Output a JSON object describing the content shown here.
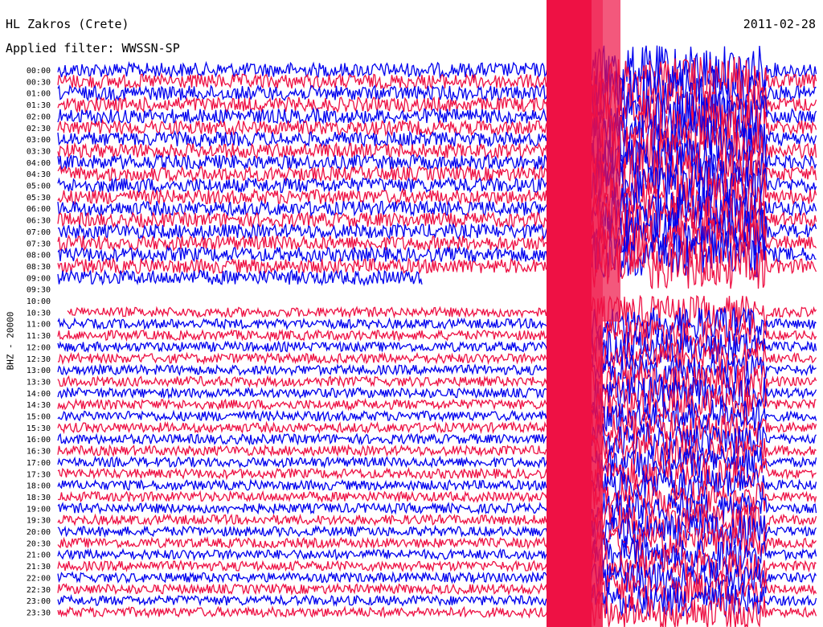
{
  "header": {
    "station": "HL Zakros (Crete)",
    "date": "2011-02-28",
    "filter_label": "Applied filter: WWSSN-SP"
  },
  "chart_data": {
    "type": "line",
    "title": "HL Zakros (Crete)",
    "subtitle": "Applied filter: WWSSN-SP",
    "ylabel": "BHZ - 20000",
    "row_labels": [
      "00:00",
      "00:30",
      "01:00",
      "01:30",
      "02:00",
      "02:30",
      "03:00",
      "03:30",
      "04:00",
      "04:30",
      "05:00",
      "05:30",
      "06:00",
      "06:30",
      "07:00",
      "07:30",
      "08:00",
      "08:30",
      "09:00",
      "09:30",
      "10:00",
      "10:30",
      "11:00",
      "11:30",
      "12:00",
      "12:30",
      "13:00",
      "13:30",
      "14:00",
      "14:30",
      "15:00",
      "15:30",
      "16:00",
      "16:30",
      "17:00",
      "17:30",
      "18:00",
      "18:30",
      "19:00",
      "19:30",
      "20:00",
      "20:30",
      "21:00",
      "21:30",
      "22:00",
      "22:30",
      "23:00",
      "23:30"
    ],
    "series_colors": [
      "#0000ee",
      "#ee1144"
    ],
    "data_gap": {
      "from": "09:30",
      "to": "10:30"
    },
    "event_window_minutes": [
      21,
      28
    ],
    "grid": false
  }
}
